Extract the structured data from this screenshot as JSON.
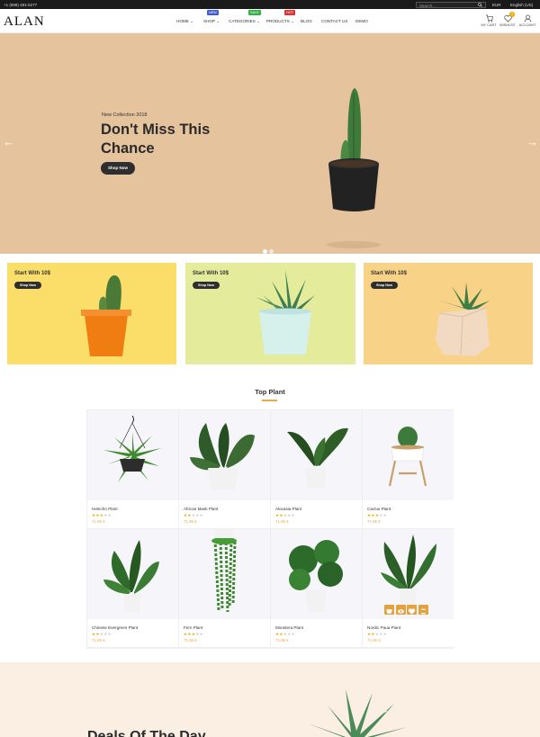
{
  "topbar": {
    "phone": "+1 (888) 491-5277",
    "search_placeholder": "Search...",
    "currency": "EUR",
    "language": "English (US)"
  },
  "header": {
    "logo": "ALAN",
    "nav": [
      {
        "label": "HOME",
        "has_dropdown": true
      },
      {
        "label": "SHOP",
        "has_dropdown": true,
        "badge": "NEW",
        "badge_color": "#3b5bdb"
      },
      {
        "label": "CATEGORIES",
        "has_dropdown": true,
        "badge": "SALE",
        "badge_color": "#2fb344"
      },
      {
        "label": "PRODUCTS",
        "has_dropdown": true,
        "badge": "HOT",
        "badge_color": "#e03131"
      },
      {
        "label": "BLOG",
        "has_dropdown": false
      },
      {
        "label": "CONTACT US",
        "has_dropdown": false
      },
      {
        "label": "DEMO",
        "has_dropdown": false
      }
    ],
    "icons": [
      {
        "name": "cart-icon",
        "label": "MY CART"
      },
      {
        "name": "heart-icon",
        "label": "WISHLIST",
        "count": "0"
      },
      {
        "name": "user-icon",
        "label": "ACCOUNT"
      }
    ]
  },
  "hero": {
    "subtitle": "New Collection 2018",
    "title": "Don't Miss This Chance",
    "button": "Shop Now",
    "slides": 2,
    "active_slide": 1,
    "bg_color": "#e5c49d"
  },
  "promos": [
    {
      "title": "Start With 10$",
      "button": "Shop Now",
      "bg_color": "#fbde6a"
    },
    {
      "title": "Start With 10$",
      "button": "Shop Now",
      "bg_color": "#e4ec9c"
    },
    {
      "title": "Start With 10$",
      "button": "Shop Now",
      "bg_color": "#f8d286"
    }
  ],
  "top_plant": {
    "title": "Top Plant",
    "accent": "#e8a94a",
    "products": [
      {
        "name": "Helecho Plant",
        "rating": 3,
        "price": "71.95 €"
      },
      {
        "name": "African Mask Plant",
        "rating": 2,
        "price": "71.95 €"
      },
      {
        "name": "Alocasia Plant",
        "rating": 2,
        "price": "71.95 €"
      },
      {
        "name": "Cactus Plant",
        "rating": 3,
        "price": "71.95 €"
      },
      {
        "name": "Chinese Evergreen Plant",
        "rating": 2,
        "price": "71.95 €"
      },
      {
        "name": "Fern Plant",
        "rating": 3,
        "price": "71.95 €"
      },
      {
        "name": "Monstera Plant",
        "rating": 2,
        "price": "71.95 €"
      },
      {
        "name": "Nordic Paua Plant",
        "rating": 2,
        "price": "71.95 €"
      }
    ],
    "quick_actions": [
      "cart-icon",
      "eye-icon",
      "heart-icon",
      "compare-icon"
    ]
  },
  "bottom_banner": {
    "title": "Deals Of The Day",
    "bg_color": "#fbeee3"
  }
}
